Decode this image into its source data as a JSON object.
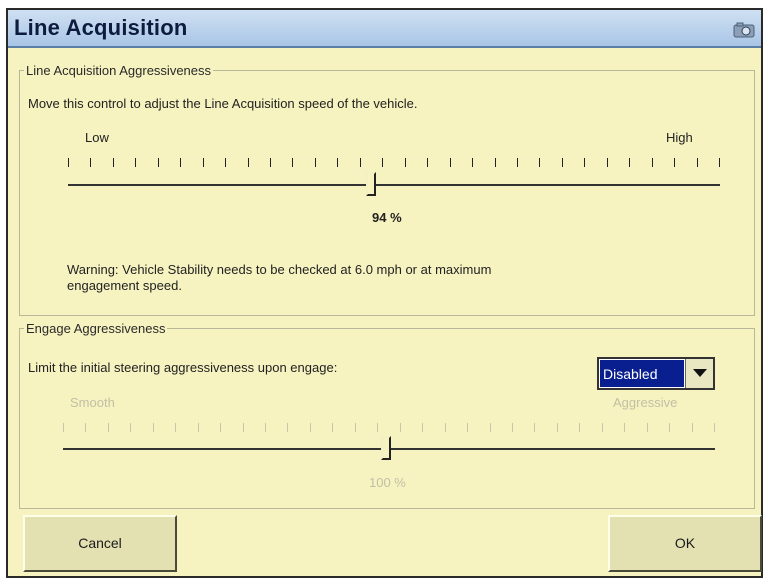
{
  "window": {
    "title": "Line Acquisition",
    "icon": "camera-icon"
  },
  "line_acquisition": {
    "legend": "Line Acquisition Aggressiveness",
    "description": "Move this control to adjust the Line Acquisition speed of the vehicle.",
    "low_label": "Low",
    "high_label": "High",
    "value_percent": 94,
    "value_label": "94 %",
    "warning_line1": "Warning: Vehicle Stability needs to be checked at 6.0 mph or at maximum",
    "warning_line2": "engagement speed."
  },
  "engage": {
    "legend": "Engage Aggressiveness",
    "description": "Limit the initial steering aggressiveness upon engage:",
    "select_value": "Disabled",
    "smooth_label": "Smooth",
    "aggressive_label": "Aggressive",
    "value_percent": 100,
    "value_label": "100 %",
    "enabled": false
  },
  "buttons": {
    "cancel": "Cancel",
    "ok": "OK"
  },
  "colors": {
    "background": "#f6f3c0",
    "title_bar": "#a9c5e6",
    "select_highlight": "#0a1f8f"
  }
}
